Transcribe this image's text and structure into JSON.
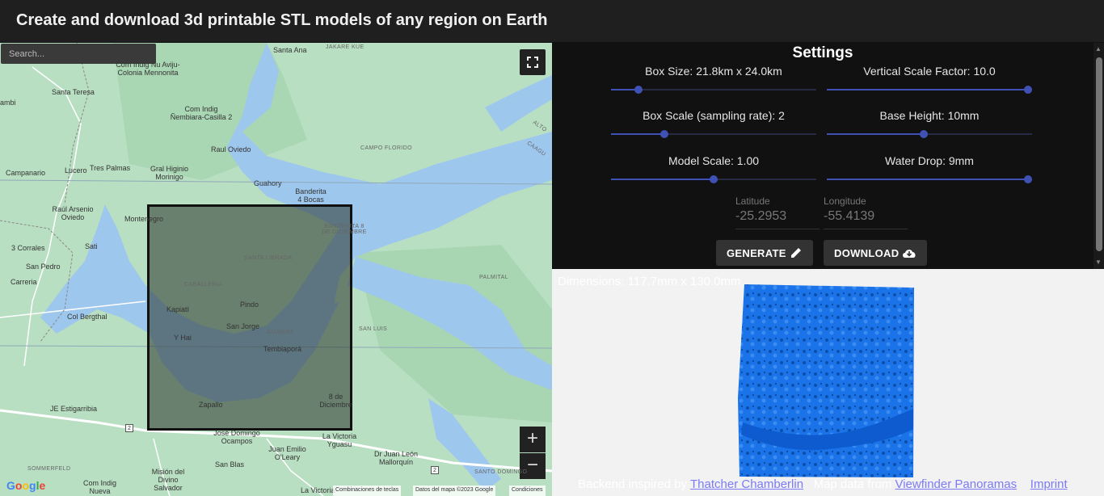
{
  "header": {
    "title": "Create and download 3d printable STL models of any region on Earth"
  },
  "map": {
    "search_placeholder": "Search...",
    "zoom_in": "+",
    "zoom_out": "−",
    "labels": [
      "Santa Ana",
      "JAKARE KUE",
      "Com Indig Nu Aviju-Colonia Mennonita",
      "Santa Teresa",
      "ambi",
      "Com Indig Ñembiara-Casilla 2",
      "Raul Oviedo",
      "CAMPO FLORIDO",
      "Campanario",
      "Lucero",
      "Tres Palmas",
      "Gral Higinio Morinigo",
      "Guahory",
      "Banderita 4 Bocas",
      "Raúl Arsenio Oviedo",
      "Montenegro",
      "BANDERITA 8 DE DICIEMBRE",
      "Sati",
      "3 Corrales",
      "San Pedro",
      "Carreria",
      "SANTA LIBRADA",
      "CABALLERIA",
      "PALMITAL",
      "Kapiatí",
      "Pindo",
      "Col Bergthal",
      "San Jorge",
      "GUAVIRA",
      "SAN LUIS",
      "Y Hai",
      "Tembiaporá",
      "8 de Diciembre",
      "JE Estigarribia",
      "Zapallo",
      "José Domingo Ocampos",
      "La Victoria Yguasu",
      "Juan Emilio O'Leary",
      "Dr Juan León Mallorquín",
      "SOMMERFELD",
      "San Blas",
      "SANTO DOMINGO",
      "Com Indig Nueva",
      "Misión del Divino Salvador",
      "La Victoria",
      "ALTO",
      "CAAGU"
    ],
    "attribution": {
      "shortcuts": "Combinaciones de teclas",
      "mapdata": "Datos del mapa ©2023 Google",
      "terms": "Condiciones",
      "logo": "Google"
    },
    "road_shields": [
      "2",
      "2"
    ]
  },
  "settings": {
    "title": "Settings",
    "sliders": [
      {
        "label": "Box Size: 21.8km x 24.0km",
        "value": 0.12
      },
      {
        "label": "Vertical Scale Factor: 10.0",
        "value": 1.0
      },
      {
        "label": "Box Scale (sampling rate): 2",
        "value": 0.25
      },
      {
        "label": "Base Height: 10mm",
        "value": 0.47
      },
      {
        "label": "Model Scale: 1.00",
        "value": 0.5
      },
      {
        "label": "Water Drop: 9mm",
        "value": 1.0
      }
    ],
    "latitude_label": "Latitude",
    "latitude_value": "-25.2953",
    "longitude_label": "Longitude",
    "longitude_value": "-55.4139",
    "generate_label": "GENERATE",
    "download_label": "DOWNLOAD"
  },
  "preview": {
    "dimensions": "Dimensions: 117.7mm x 130.0mm",
    "footer_prefix": "Backend inspired by",
    "footer_link1": "Thatcher Chamberlin",
    "footer_mid": "Map data from",
    "footer_link2": "Viewfinder Panoramas",
    "footer_link3": "Imprint",
    "model_color": "#1a73e8"
  }
}
